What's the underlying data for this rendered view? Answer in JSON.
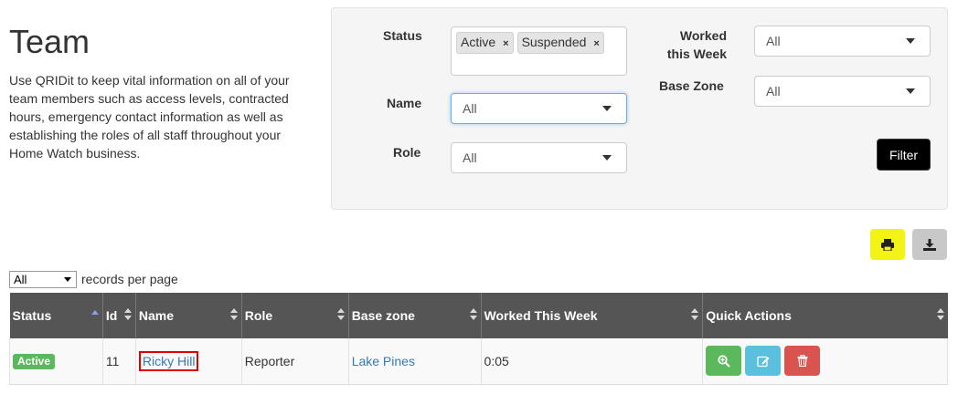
{
  "page": {
    "title": "Team",
    "intro": "Use QRIDit to keep vital information on all of your team members such as access levels, contracted hours, emergency contact information as well as establishing the roles of all staff throughout your Home Watch business."
  },
  "filters": {
    "status": {
      "label": "Status",
      "tags": [
        "Active",
        "Suspended"
      ],
      "remove_glyph": "×"
    },
    "name": {
      "label": "Name",
      "value": "All"
    },
    "role": {
      "label": "Role",
      "value": "All"
    },
    "worked": {
      "label_line1": "Worked",
      "label_line2": "this Week",
      "value": "All"
    },
    "base_zone": {
      "label": "Base Zone",
      "value": "All"
    },
    "filter_button": "Filter"
  },
  "toolbar": {
    "print_icon": "print-icon",
    "download_icon": "download-icon",
    "print_color": "#f3f315",
    "download_color": "#c8c8c8"
  },
  "records": {
    "selected": "All",
    "label": "records per page"
  },
  "table": {
    "headers": [
      "Status",
      "Id",
      "Name",
      "Role",
      "Base zone",
      "Worked This Week",
      "Quick Actions"
    ],
    "rows": [
      {
        "status": "Active",
        "id": "11",
        "name": "Ricky Hill",
        "role": "Reporter",
        "base_zone": "Lake Pines",
        "worked": "0:05"
      }
    ],
    "actions": [
      "search-plus-icon",
      "edit-icon",
      "trash-icon"
    ]
  },
  "colors": {
    "header_bg": "#555555",
    "active_green": "#5cb85c",
    "info_blue": "#5bc0de",
    "danger_red": "#d9534f",
    "link_blue": "#337ab7",
    "highlight_red": "#e00000"
  }
}
